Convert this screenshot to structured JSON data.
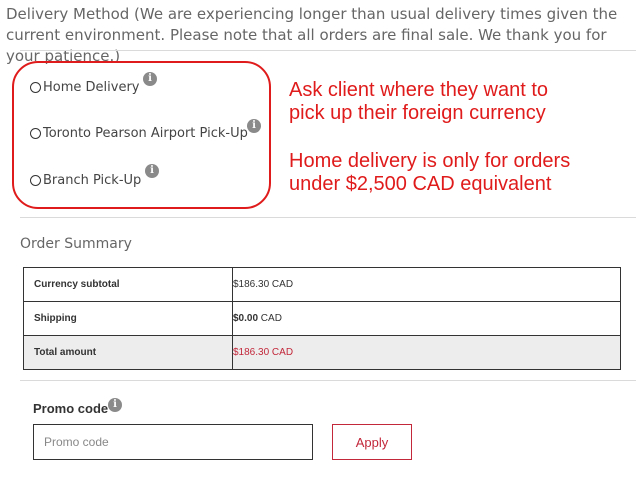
{
  "delivery": {
    "title": "Delivery Method (We are experiencing longer than usual delivery times given the current environment. Please note that all orders are final sale. We thank you for your patience.)",
    "options": [
      {
        "label": "Home Delivery"
      },
      {
        "label": "Toronto Pearson Airport Pick-Up"
      },
      {
        "label": "Branch Pick-Up"
      }
    ],
    "info_glyph": "i"
  },
  "annotation": {
    "line1": "Ask client where they want to",
    "line2": "pick up their foreign currency",
    "line3": "Home delivery is only for orders",
    "line4": "under $2,500 CAD equivalent",
    "color": "#e01b1b"
  },
  "summary": {
    "title": "Order Summary",
    "rows": [
      {
        "label": "Currency subtotal",
        "value": "$186.30 CAD"
      },
      {
        "label": "Shipping",
        "value_amount": "$0.00",
        "value_unit": " CAD"
      },
      {
        "label": "Total amount",
        "value": "$186.30 CAD"
      }
    ],
    "accent": "#c2273a"
  },
  "promo": {
    "label": "Promo code",
    "placeholder": "Promo code",
    "apply_label": "Apply"
  }
}
